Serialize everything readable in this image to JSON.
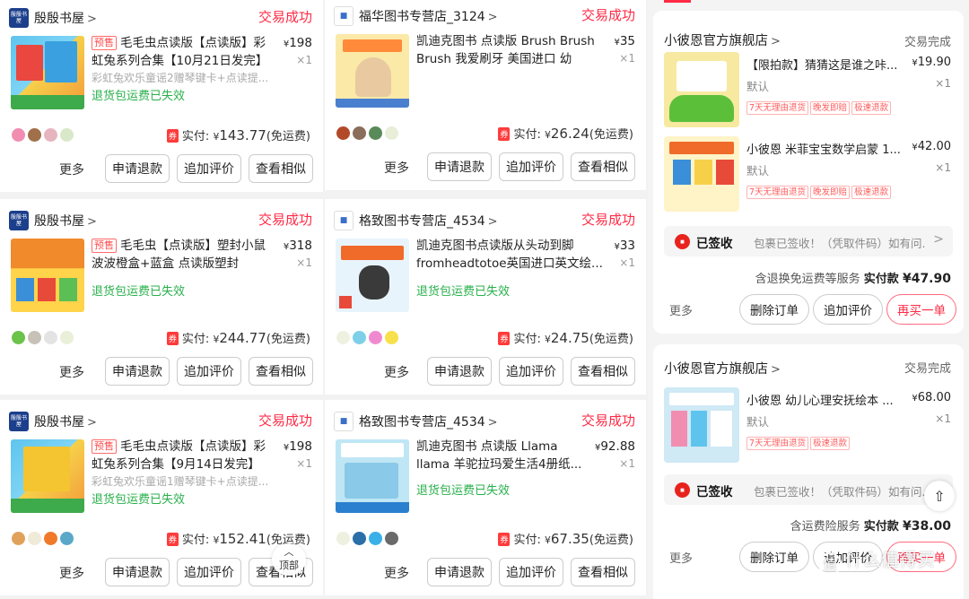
{
  "colors": {
    "accent_red": "#ff2a45",
    "green": "#28b04b"
  },
  "col1": [
    {
      "shop": "殷殷书屋",
      "shop_logo_text": "殷殷书屋",
      "status": "交易成功",
      "pre_tag": "预售",
      "title": "毛毛虫点读版【点读版】彩虹兔系列合集【10月21日发完】",
      "price_symbol": "¥",
      "price": "198",
      "qty": "×1",
      "sku": "彩虹兔欢乐童谣2赠琴键卡+点读提...",
      "refund": "退货包运费已失效",
      "coupon": "券",
      "paid_label": "实付:",
      "paid_symbol": "¥",
      "paid_amount": "143.77",
      "paid_note": "(免运费)",
      "more": "更多",
      "btn_refund": "申请退款",
      "btn_review": "追加评价",
      "btn_similar": "查看相似"
    },
    {
      "shop": "殷殷书屋",
      "shop_logo_text": "殷殷书屋",
      "status": "交易成功",
      "pre_tag": "预售",
      "title": "毛毛虫【点读版】塑封小鼠波波橙盒+蓝盒 点读版塑封【9...",
      "price_symbol": "¥",
      "price": "318",
      "qty": "×1",
      "sku": "",
      "refund": "退货包运费已失效",
      "coupon": "券",
      "paid_label": "实付:",
      "paid_symbol": "¥",
      "paid_amount": "244.77",
      "paid_note": "(免运费)",
      "more": "更多",
      "btn_refund": "申请退款",
      "btn_review": "追加评价",
      "btn_similar": "查看相似"
    },
    {
      "shop": "殷殷书屋",
      "shop_logo_text": "殷殷书屋",
      "status": "交易成功",
      "pre_tag": "预售",
      "title": "毛毛虫点读版【点读版】彩虹兔系列合集【9月14日发完】",
      "price_symbol": "¥",
      "price": "198",
      "qty": "×1",
      "sku": "彩虹兔欢乐童谣1赠琴键卡+点读提...",
      "refund": "退货包运费已失效",
      "coupon": "券",
      "paid_label": "实付:",
      "paid_symbol": "¥",
      "paid_amount": "152.41",
      "paid_note": "(免运费)",
      "more": "更多",
      "btn_refund": "申请退款",
      "btn_review": "追加评价",
      "btn_similar": "查看相似"
    }
  ],
  "col2": [
    {
      "shop": "福华图书专营店_3124",
      "status": "交易成功",
      "title": "凯迪克图书 点读版 Brush Brush Brush 我爱刷牙 美国进口 幼",
      "price_symbol": "¥",
      "price": "35",
      "qty": "×1",
      "refund": "",
      "coupon": "券",
      "paid_label": "实付:",
      "paid_symbol": "¥",
      "paid_amount": "26.24",
      "paid_note": "(免运费)",
      "more": "更多",
      "btn_refund": "申请退款",
      "btn_review": "追加评价",
      "btn_similar": "查看相似"
    },
    {
      "shop": "格致图书专营店_4534",
      "status": "交易成功",
      "title": "凯迪克图书点读版从头动到脚fromheadtotoe英国进口英文绘...",
      "price_symbol": "¥",
      "price": "33",
      "qty": "×1",
      "refund": "退货包运费已失效",
      "coupon": "券",
      "paid_label": "实付:",
      "paid_symbol": "¥",
      "paid_amount": "24.75",
      "paid_note": "(免运费)",
      "more": "更多",
      "btn_refund": "申请退款",
      "btn_review": "追加评价",
      "btn_similar": "查看相似"
    },
    {
      "shop": "格致图书专营店_4534",
      "status": "交易成功",
      "title": "凯迪克图书 点读版 Llama llama 羊驼拉玛爱生活4册纸...",
      "price_symbol": "¥",
      "price": "92.88",
      "qty": "×1",
      "refund": "退货包运费已失效",
      "coupon": "券",
      "paid_label": "实付:",
      "paid_symbol": "¥",
      "paid_amount": "67.35",
      "paid_note": "(免运费)",
      "more": "更多",
      "btn_refund": "申请退款",
      "btn_review": "追加评价",
      "btn_similar": "查看相似"
    }
  ],
  "col3": {
    "card1": {
      "shop": "小彼恩官方旗舰店",
      "status": "交易完成",
      "items": [
        {
          "title": "【限拍款】猜猜这是谁之咔...",
          "price_symbol": "¥",
          "price": "19.90",
          "sku": "默认",
          "qty": "×1",
          "tags": [
            "7天无理由退货",
            "晚发即赔",
            "极速退款"
          ]
        },
        {
          "title": "小彼恩 米菲宝宝数学启蒙 1...",
          "price_symbol": "¥",
          "price": "42.00",
          "sku": "默认",
          "qty": "×1",
          "tags": [
            "7天无理由退货",
            "晚发即赔",
            "极速退款"
          ]
        }
      ],
      "logi_status": "已签收",
      "logi_text": "包裹已签收！（凭取件码）如有问...",
      "summary_note": "含退换免运费等服务",
      "summary_label": "实付款",
      "summary_symbol": "¥",
      "summary_amount": "47.90",
      "more": "更多",
      "btn_delete": "删除订单",
      "btn_review": "追加评价",
      "btn_rebuy": "再买一单"
    },
    "card2": {
      "shop": "小彼恩官方旗舰店",
      "status": "交易完成",
      "items": [
        {
          "title": "小彼恩 幼儿心理安抚绘本 ...",
          "price_symbol": "¥",
          "price": "68.00",
          "sku": "默认",
          "qty": "×1",
          "tags": [
            "7天无理由退货",
            "极速退款"
          ]
        }
      ],
      "logi_status": "已签收",
      "logi_text": "包裹已签收！（凭取件码）如有问...",
      "summary_note": "含运费险服务",
      "summary_label": "实付款",
      "summary_symbol": "¥",
      "summary_amount": "38.00",
      "more": "更多",
      "btn_delete": "删除订单",
      "btn_review": "追加评价",
      "btn_rebuy": "再买一单"
    }
  },
  "float": {
    "top_label": "顶部",
    "top_arrow": "︿"
  },
  "watermark": "什么值得买",
  "watermark_logo": "值",
  "icons": {
    "chevron": "chevron-right-icon",
    "back_to_top": "arrow-up-icon"
  }
}
